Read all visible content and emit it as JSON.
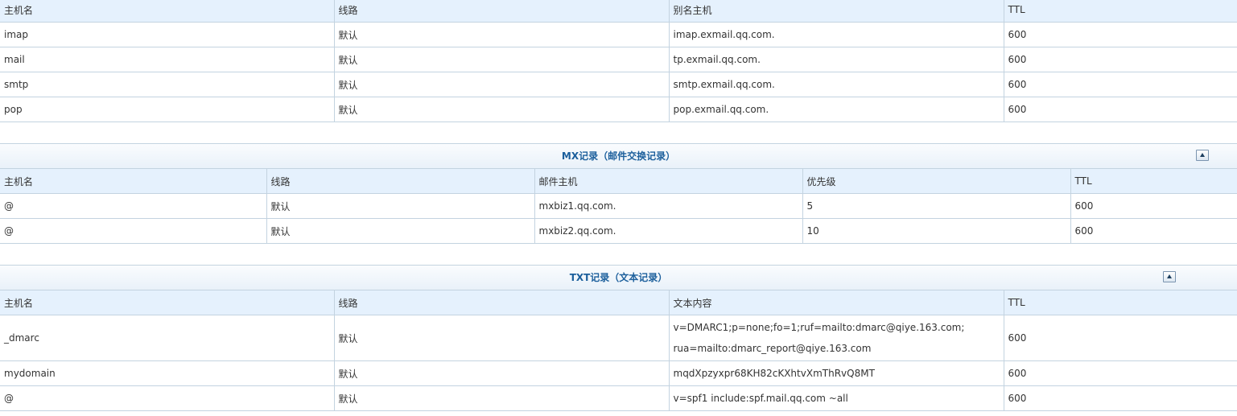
{
  "cname": {
    "headers": [
      "主机名",
      "线路",
      "别名主机",
      "TTL"
    ],
    "rows": [
      [
        "imap",
        "默认",
        "imap.exmail.qq.com.",
        "600"
      ],
      [
        "mail",
        "默认",
        "tp.exmail.qq.com.",
        "600"
      ],
      [
        "smtp",
        "默认",
        "smtp.exmail.qq.com.",
        "600"
      ],
      [
        "pop",
        "默认",
        "pop.exmail.qq.com.",
        "600"
      ]
    ]
  },
  "mx": {
    "title": "MX记录（邮件交换记录）",
    "collapse_icon": "collapse-up-icon",
    "headers": [
      "主机名",
      "线路",
      "邮件主机",
      "优先级",
      "TTL"
    ],
    "rows": [
      [
        "@",
        "默认",
        "mxbiz1.qq.com.",
        "5",
        "600"
      ],
      [
        "@",
        "默认",
        "mxbiz2.qq.com.",
        "10",
        "600"
      ]
    ]
  },
  "txt": {
    "title": "TXT记录（文本记录）",
    "collapse_icon": "collapse-up-icon",
    "headers": [
      "主机名",
      "线路",
      "文本内容",
      "TTL"
    ],
    "rows": [
      [
        "_dmarc",
        "默认",
        "v=DMARC1;p=none;fo=1;ruf=mailto:dmarc@qiye.163.com;",
        "rua=mailto:dmarc_report@qiye.163.com",
        "600"
      ],
      [
        "mydomain",
        "默认",
        "mqdXpzyxpr68KH82cKXhtvXmThRvQ8MT",
        "",
        "600"
      ],
      [
        "@",
        "默认",
        "v=spf1 include:spf.mail.qq.com ~all",
        "",
        "600"
      ]
    ]
  },
  "colors": {
    "header_bg": "#e5f1fd",
    "border": "#c3d3e0",
    "title": "#1c5f9c"
  }
}
